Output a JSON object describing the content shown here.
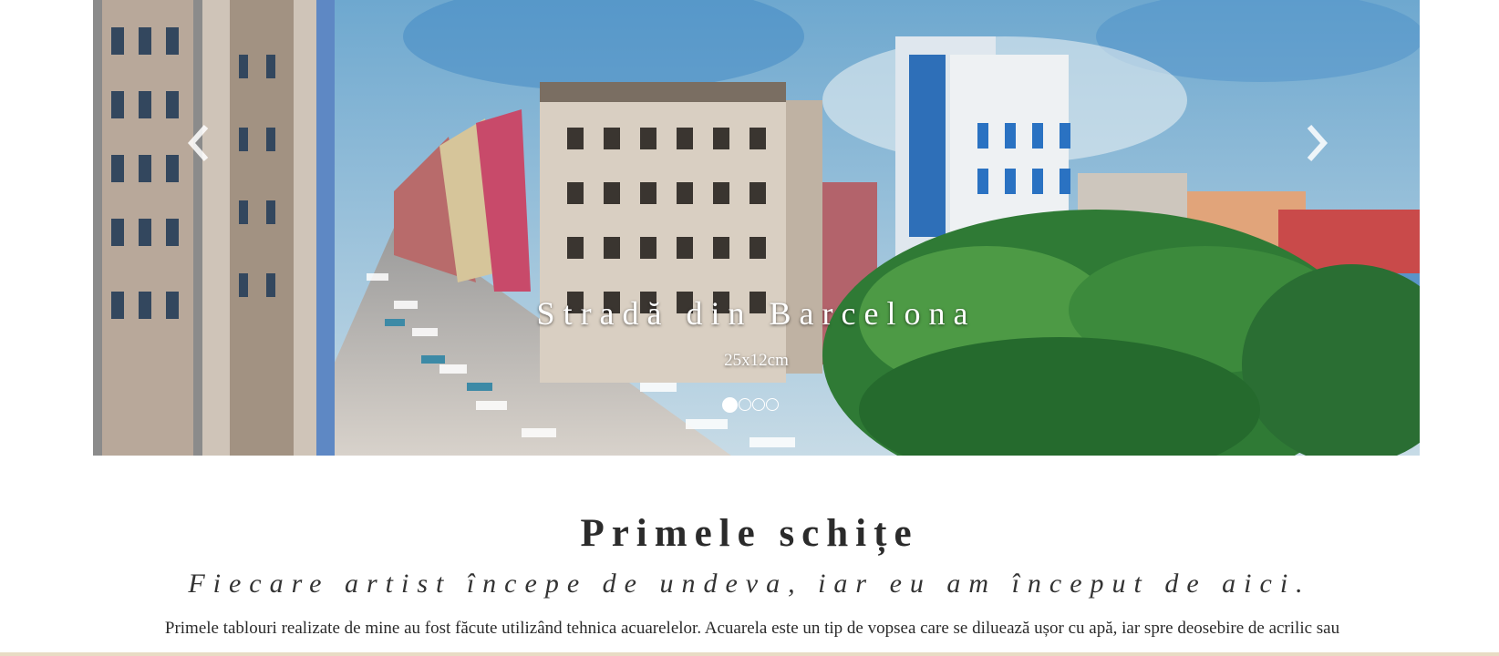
{
  "carousel": {
    "slide_title": "Stradă din Barcelona",
    "slide_size": "25x12cm",
    "prev_icon": "chevron-left-icon",
    "next_icon": "chevron-right-icon",
    "indicator_count": 4,
    "active_index": 0
  },
  "section": {
    "title": "Primele schițe",
    "subtitle": "Fiecare artist începe de undeva, iar eu am început de aici.",
    "body": "Primele tablouri realizate de mine au fost făcute utilizând tehnica acuarelelor. Acuarela este un tip de vopsea care se diluează ușor cu apă, iar spre deosebire de acrilic sau"
  }
}
